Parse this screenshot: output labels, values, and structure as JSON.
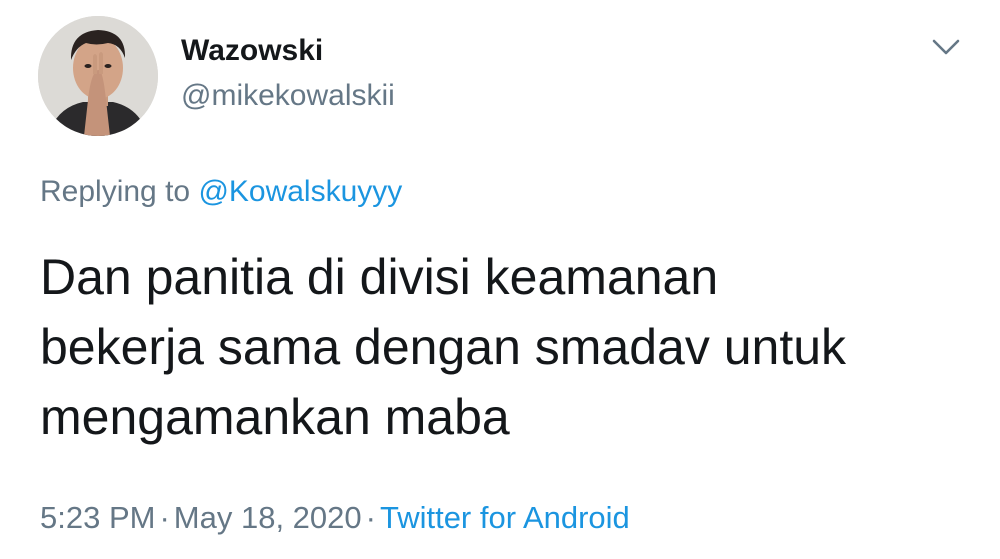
{
  "tweet": {
    "display_name": "Wazowski",
    "handle": "@mikekowalskii",
    "avatar_icon": "profile-photo",
    "menu_icon": "chevron-down-icon",
    "reply": {
      "prefix": "Replying to",
      "mention": "@Kowalskuyyy"
    },
    "text_lines": [
      "Dan panitia di divisi keamanan",
      "bekerja sama dengan smadav untuk",
      "mengamankan maba"
    ],
    "time": "5:23 PM",
    "separator": "·",
    "date": "May 18, 2020",
    "source": "Twitter for Android"
  },
  "colors": {
    "text": "#14171a",
    "secondary": "#657786",
    "link": "#1b95e0",
    "background": "#ffffff"
  }
}
